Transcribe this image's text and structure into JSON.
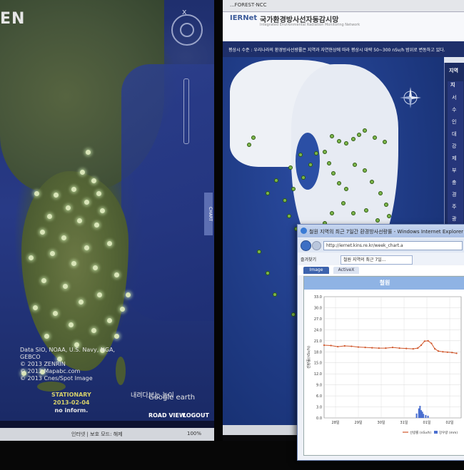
{
  "left_screen": {
    "logo": "EN",
    "attribution": [
      "Data SIO, NOAA, U.S. Navy, NGA, GEBCO",
      "© 2013 ZENRIN",
      "© 2013 Mapabc.com",
      "© 2013 Cnes/Spot Image"
    ],
    "google": "Google earth",
    "caption": "내려다보는 높이",
    "stationary": "STATIONARY",
    "date": "2013-02-04",
    "inform": "no inform.",
    "road_view": "ROAD VIEW",
    "logout": "LOGOUT",
    "status_text": "인터넷 | 보호 모드: 해제",
    "zoom": "100%",
    "chart_tab": "CHART",
    "close": "x"
  },
  "right_screen": {
    "toolbar_text": "...FOREST·NCC",
    "logo": "IERNet",
    "site_title": "국가환경방사선자동감시망",
    "site_subtitle": "Integrated Environmental Radiation Monitoring Network",
    "notice": "평상시 수준 : 우리나라의 환경방사선량률은 지역과 자연현상에 따라 평상시 대략 50~300 nSv/h 범위로 변동하고 있다.",
    "sidebar_title": "지역",
    "sidebar_head": "지",
    "sidebar_chars": [
      "서",
      "수",
      "인",
      "대",
      "강",
      "제",
      "부",
      "충",
      "경",
      "주",
      "광",
      "양"
    ]
  },
  "popup": {
    "title": "철원 지역의 최근 7일간 환경방사선량률 - Windows Internet Explorer",
    "url": "http://iernet.kins.re.kr/week_chart.a",
    "favorites": "즐겨찾기",
    "tab_title": "철원 지역의 최근 7일...",
    "tab_image": "Image",
    "tab_activex": "ActiveX",
    "chart_title": "철원"
  },
  "chart_data": {
    "type": "line",
    "title": "철원",
    "ylabel": "선량률(nSv/h)",
    "ylim": [
      0,
      33
    ],
    "yticks": [
      "33.0",
      "30.0",
      "27.0",
      "24.0",
      "21.0",
      "18.0",
      "15.0",
      "12.0",
      "9.0",
      "6.0",
      "3.0",
      "0.0"
    ],
    "xticks": [
      "28일",
      "29일",
      "30일",
      "31일",
      "01일",
      "02일"
    ],
    "series": [
      {
        "name": "선량률",
        "unit": "(nSv/h)",
        "color": "#d0562a",
        "x": [
          0,
          0.3,
          0.6,
          0.9,
          1.2,
          1.5,
          1.8,
          2.1,
          2.4,
          2.7,
          3.0,
          3.3,
          3.6,
          3.9,
          4.1,
          4.25,
          4.4,
          4.55,
          4.7,
          4.85,
          5.0,
          5.2,
          5.4,
          5.6,
          5.8
        ],
        "values": [
          19.8,
          19.7,
          19.4,
          19.6,
          19.5,
          19.3,
          19.2,
          19.1,
          19.0,
          19.0,
          19.2,
          19.0,
          18.9,
          18.8,
          19.0,
          19.8,
          20.9,
          21.0,
          20.3,
          18.8,
          18.2,
          18.0,
          17.9,
          17.8,
          17.6
        ]
      },
      {
        "name": "강우량",
        "unit": "(mm)",
        "color": "#4a6fd0",
        "bars": [
          [
            4.05,
            1.2
          ],
          [
            4.15,
            2.6
          ],
          [
            4.2,
            3.3
          ],
          [
            4.25,
            2.1
          ],
          [
            4.3,
            1.7
          ],
          [
            4.35,
            1.1
          ],
          [
            4.45,
            0.8
          ],
          [
            4.55,
            0.6
          ]
        ]
      }
    ]
  }
}
